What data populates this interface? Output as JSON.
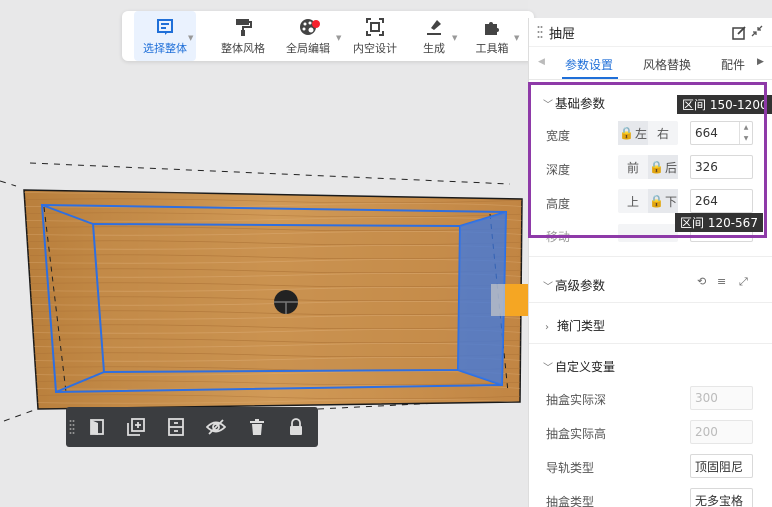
{
  "toolbar": {
    "items": [
      {
        "label": "选择整体",
        "icon": "list-icon"
      },
      {
        "label": "整体风格",
        "icon": "paint-roller-icon"
      },
      {
        "label": "全局编辑",
        "icon": "palette-icon"
      },
      {
        "label": "内空设计",
        "icon": "frame-icon"
      },
      {
        "label": "生成",
        "icon": "gavel-icon"
      },
      {
        "label": "工具箱",
        "icon": "puzzle-icon"
      }
    ]
  },
  "float_bar": {
    "icons": [
      "door-icon",
      "add-panel-icon",
      "drawer-icon",
      "hide-icon",
      "delete-icon",
      "lock-icon"
    ]
  },
  "panel": {
    "title": "抽屉",
    "tabs": [
      "参数设置",
      "风格替换",
      "配件"
    ],
    "basic": {
      "title": "基础参数",
      "width": {
        "label": "宽度",
        "opt_a": "左",
        "opt_b": "右",
        "value": "664",
        "tip": "区间 150-1200"
      },
      "depth": {
        "label": "深度",
        "opt_a": "前",
        "opt_b": "后",
        "value": "326"
      },
      "height": {
        "label": "高度",
        "opt_a": "上",
        "opt_b": "下",
        "value": "264",
        "tip": "区间 120-567"
      },
      "move": {
        "label": "移动"
      }
    },
    "advanced": {
      "title": "高级参数",
      "door_type": "掩门类型",
      "custom_vars": "自定义变量",
      "rows": [
        {
          "label": "抽盒实际深",
          "value": "300"
        },
        {
          "label": "抽盒实际高",
          "value": "200"
        },
        {
          "label": "导轨类型",
          "value": "顶固阻尼"
        },
        {
          "label": "抽盒类型",
          "value": "无多宝格"
        }
      ]
    }
  },
  "colors": {
    "accent": "#1f6fd8",
    "highlight": "#8e3aa8",
    "wood": "#c8924e",
    "selection": "#2f6fe0"
  }
}
